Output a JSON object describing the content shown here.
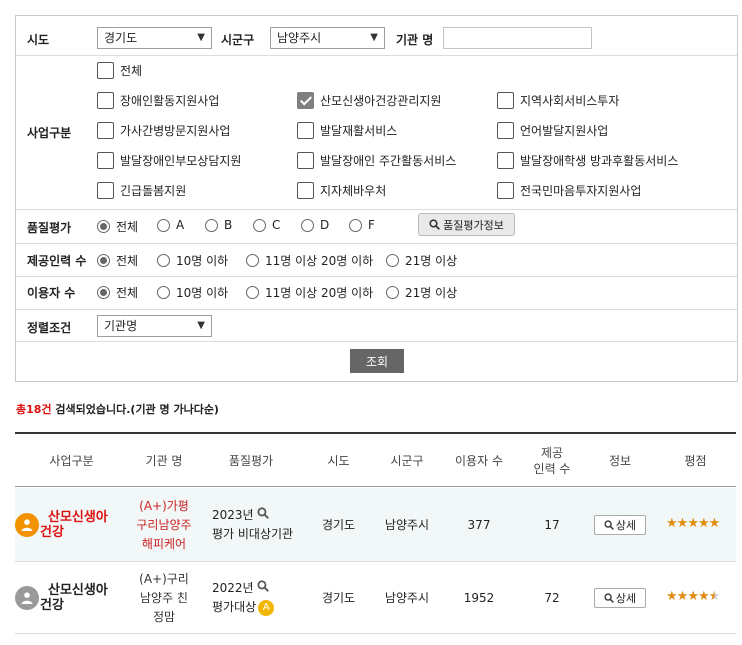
{
  "filters": {
    "sido_label": "시도",
    "sido_value": "경기도",
    "sigungu_label": "시군구",
    "sigungu_value": "남양주시",
    "org_name_label": "기관 명",
    "org_name_value": "",
    "business_type_label": "사업구분",
    "business_types": [
      {
        "label": "전체",
        "checked": false
      },
      {
        "label": "장애인활동지원사업",
        "checked": false
      },
      {
        "label": "산모신생아건강관리지원",
        "checked": true
      },
      {
        "label": "지역사회서비스투자",
        "checked": false
      },
      {
        "label": "가사간병방문지원사업",
        "checked": false
      },
      {
        "label": "발달재활서비스",
        "checked": false
      },
      {
        "label": "언어발달지원사업",
        "checked": false
      },
      {
        "label": "발달장애인부모상담지원",
        "checked": false
      },
      {
        "label": "발달장애인 주간활동서비스",
        "checked": false
      },
      {
        "label": "발달장애학생 방과후활동서비스",
        "checked": false
      },
      {
        "label": "긴급돌봄지원",
        "checked": false
      },
      {
        "label": "지자체바우처",
        "checked": false
      },
      {
        "label": "전국민마음투자지원사업",
        "checked": false
      }
    ],
    "quality_label": "품질평가",
    "quality_options": [
      "전체",
      "A",
      "B",
      "C",
      "D",
      "F"
    ],
    "quality_selected": "전체",
    "quality_info_button": "품질평가정보",
    "staff_label": "제공인력 수",
    "staff_options": [
      "전체",
      "10명 이하",
      "11명 이상 20명 이하",
      "21명 이상"
    ],
    "staff_selected": "전체",
    "users_label": "이용자 수",
    "users_options": [
      "전체",
      "10명 이하",
      "11명 이상 20명 이하",
      "21명 이상"
    ],
    "users_selected": "전체",
    "sort_label": "정렬조건",
    "sort_value": "기관명",
    "search_button": "조회"
  },
  "result": {
    "count_text": "총18건",
    "suffix_text": " 검색되었습니다.(기관 명 가나다순)"
  },
  "table": {
    "headers": [
      "사업구분",
      "기관 명",
      "품질평가",
      "시도",
      "시군구",
      "이용자 수",
      "제공\n인력 수",
      "정보",
      "평점"
    ],
    "rows": [
      {
        "service_line1": "산모신생아",
        "service_line2": "건강",
        "service_color": "#d11",
        "badge_color": "#f39200",
        "org_lines": [
          "(A+)가평",
          "구리남양주",
          "해피케어"
        ],
        "org_color": "#c22",
        "quality_year": "2023년",
        "quality_status": "평가 비대상기관",
        "quality_grade": "",
        "sido": "경기도",
        "sigungu": "남양주시",
        "users": "377",
        "staff": "17",
        "info_button": "상세",
        "rating": 5,
        "highlighted": true
      },
      {
        "service_line1": "산모신생아",
        "service_line2": "건강",
        "service_color": "#222",
        "badge_color": "#9a9a9a",
        "org_lines": [
          "(A+)구리",
          "남양주 친",
          "정맘"
        ],
        "org_color": "#333",
        "quality_year": "2022년",
        "quality_status": "평가대상",
        "quality_grade": "A",
        "sido": "경기도",
        "sigungu": "남양주시",
        "users": "1952",
        "staff": "72",
        "info_button": "상세",
        "rating": 4.5,
        "highlighted": false
      }
    ]
  },
  "colors": {
    "accent_red": "#dd1111",
    "search_button_bg": "#666666",
    "star": "#e08c10",
    "row_highlight": "#f2f7f7"
  },
  "icons": [
    "chevron-down-icon",
    "magnifier-icon",
    "user-badge-icon",
    "star-icon",
    "check-icon"
  ]
}
